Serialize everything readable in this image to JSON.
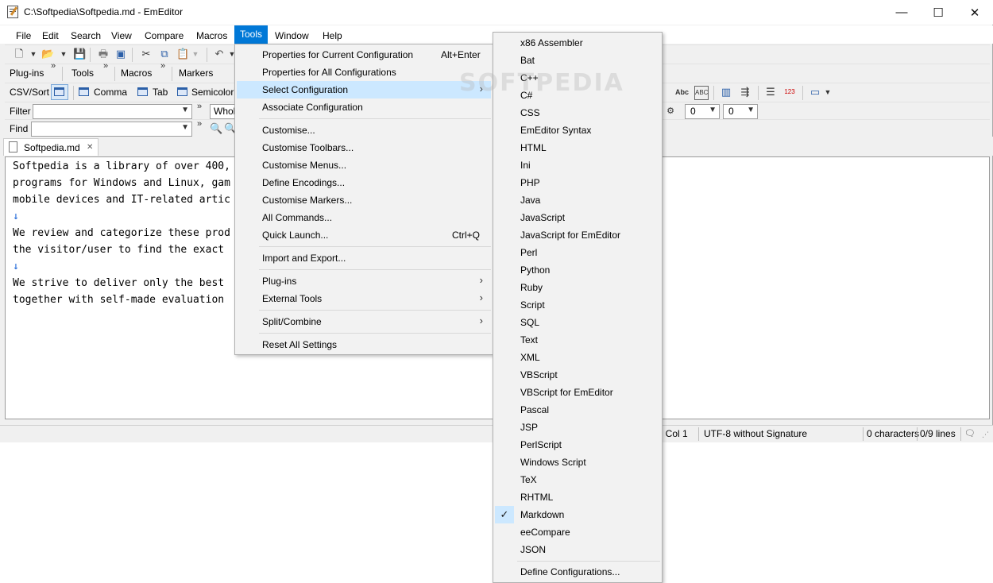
{
  "window": {
    "title": "C:\\Softpedia\\Softpedia.md - EmEditor",
    "minimize": "—",
    "maximize": "☐",
    "close": "✕"
  },
  "menubar": [
    "File",
    "Edit",
    "Search",
    "View",
    "Compare",
    "Macros",
    "Tools",
    "Window",
    "Help"
  ],
  "toolbars": {
    "row2": {
      "plugins": "Plug-ins",
      "tools": "Tools",
      "macros": "Macros",
      "markers": "Markers"
    },
    "row3": {
      "csv": "CSV/Sort",
      "comma": "Comma",
      "tab": "Tab",
      "semicolon": "Semicolor"
    },
    "filter_label": "Filter",
    "filter_value": "",
    "whole": "Whol",
    "combo1": "0",
    "combo2": "0",
    "find_label": "Find",
    "find_value": ""
  },
  "tab": {
    "name": "Softpedia.md",
    "close": "✕"
  },
  "editor": {
    "lines": [
      "Softpedia is a library of over 400,",
      "programs for Windows and Linux, gam",
      "mobile devices and IT-related artic",
      "↓",
      "We review and categorize these prod",
      "the visitor/user to find the exact",
      "↓",
      "We strive to deliver only the best",
      "together with self-made evaluation"
    ]
  },
  "status": {
    "pos": ", Col 1",
    "encoding": "UTF-8 without Signature",
    "chars": "0 characters",
    "lines": "0/9 lines"
  },
  "tools_menu": {
    "items": [
      {
        "label": "Properties for Current Configuration",
        "shortcut": "Alt+Enter"
      },
      {
        "label": "Properties for All Configurations",
        "shortcut": ""
      },
      {
        "label": "Select Configuration",
        "shortcut": "",
        "submenu": true
      },
      {
        "label": "Associate Configuration",
        "shortcut": ""
      },
      {
        "label": "Customise...",
        "shortcut": ""
      },
      {
        "label": "Customise Toolbars...",
        "shortcut": ""
      },
      {
        "label": "Customise Menus...",
        "shortcut": ""
      },
      {
        "label": "Define Encodings...",
        "shortcut": ""
      },
      {
        "label": "Customise Markers...",
        "shortcut": ""
      },
      {
        "label": "All Commands...",
        "shortcut": ""
      },
      {
        "label": "Quick Launch...",
        "shortcut": "Ctrl+Q"
      },
      {
        "label": "Import and Export...",
        "shortcut": ""
      },
      {
        "label": "Plug-ins",
        "shortcut": "",
        "submenu": true
      },
      {
        "label": "External Tools",
        "shortcut": "",
        "submenu": true
      },
      {
        "label": "Split/Combine",
        "shortcut": "",
        "submenu": true
      },
      {
        "label": "Reset All Settings",
        "shortcut": ""
      }
    ]
  },
  "config_menu": {
    "items": [
      "x86 Assembler",
      "Bat",
      "C++",
      "C#",
      "CSS",
      "EmEditor Syntax",
      "HTML",
      "Ini",
      "PHP",
      "Java",
      "JavaScript",
      "JavaScript for EmEditor",
      "Perl",
      "Python",
      "Ruby",
      "Script",
      "SQL",
      "Text",
      "XML",
      "VBScript",
      "VBScript for EmEditor",
      "Pascal",
      "JSP",
      "PerlScript",
      "Windows Script",
      "TeX",
      "RHTML",
      "Markdown",
      "eeCompare",
      "JSON"
    ],
    "checked": "Markdown",
    "define": "Define Configurations..."
  },
  "watermark": "SOFTPEDIA",
  "colors": {
    "menu_active": "#0078d7",
    "menu_highlight": "#cce8ff",
    "return_mark": "#1560d6"
  }
}
